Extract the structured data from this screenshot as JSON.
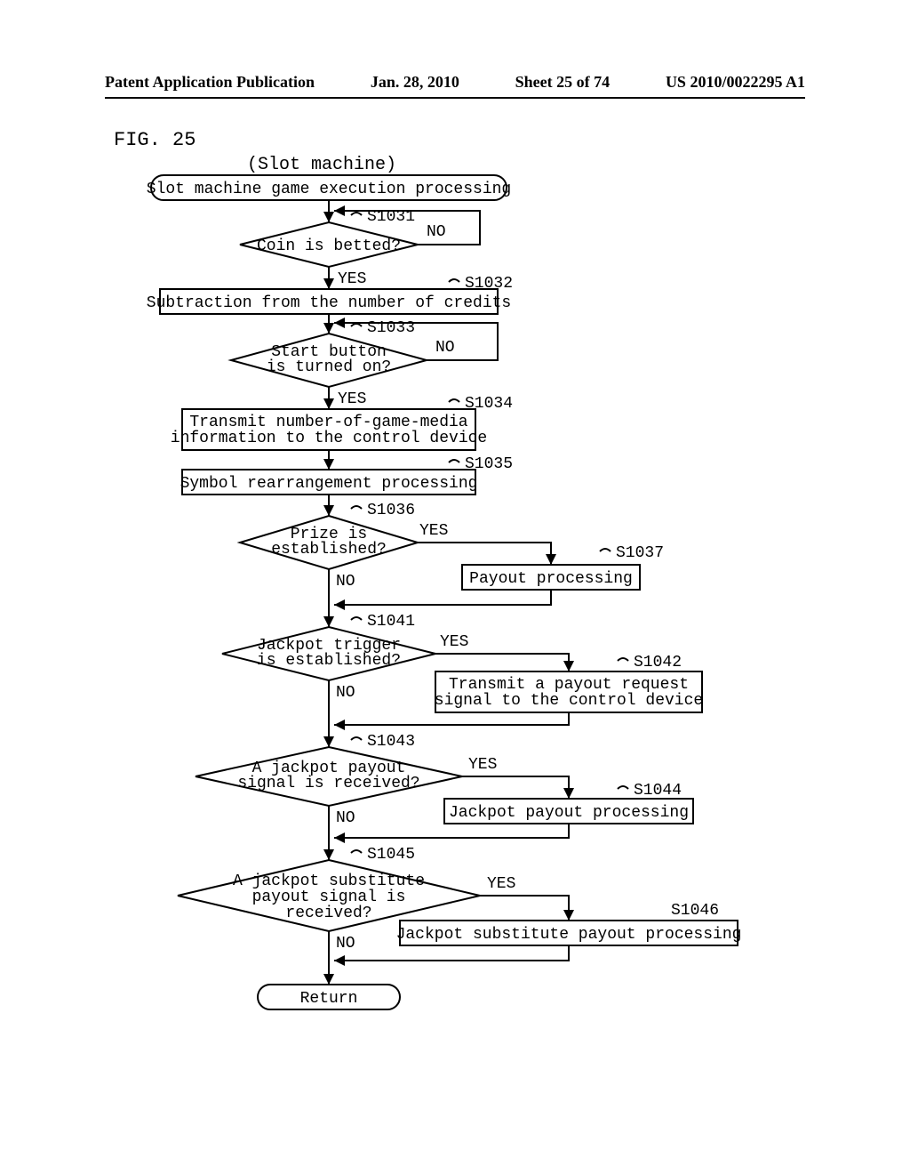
{
  "header": {
    "pub": "Patent Application Publication",
    "date": "Jan. 28, 2010",
    "sheet": "Sheet 25 of 74",
    "pubno": "US 2010/0022295 A1"
  },
  "figure_label": "FIG. 25",
  "context": "(Slot machine)",
  "nodes": {
    "start": "Slot machine game execution processing",
    "s1031": {
      "label": "S1031",
      "text": "Coin is betted?",
      "yes": "YES",
      "no": "NO"
    },
    "s1032": {
      "label": "S1032",
      "text": "Subtraction from the number of credits"
    },
    "s1033": {
      "label": "S1033",
      "text": "Start button\nis turned on?",
      "yes": "YES",
      "no": "NO"
    },
    "s1034": {
      "label": "S1034",
      "text": "Transmit number-of-game-media\ninformation to the control device"
    },
    "s1035": {
      "label": "S1035",
      "text": "Symbol rearrangement processing"
    },
    "s1036": {
      "label": "S1036",
      "text": "Prize is\nestablished?",
      "yes": "YES",
      "no": "NO"
    },
    "s1037": {
      "label": "S1037",
      "text": "Payout processing"
    },
    "s1041": {
      "label": "S1041",
      "text": "Jackpot trigger\nis established?",
      "yes": "YES",
      "no": "NO"
    },
    "s1042": {
      "label": "S1042",
      "text": "Transmit a payout request\nsignal to the control device"
    },
    "s1043": {
      "label": "S1043",
      "text": "A jackpot payout\nsignal is received?",
      "yes": "YES",
      "no": "NO"
    },
    "s1044": {
      "label": "S1044",
      "text": "Jackpot payout processing"
    },
    "s1045": {
      "label": "S1045",
      "text": "A jackpot substitute\npayout signal  is\nreceived?",
      "yes": "YES",
      "no": "NO"
    },
    "s1046": {
      "label": "S1046",
      "text": "Jackpot substitute payout processing"
    },
    "return": "Return"
  }
}
